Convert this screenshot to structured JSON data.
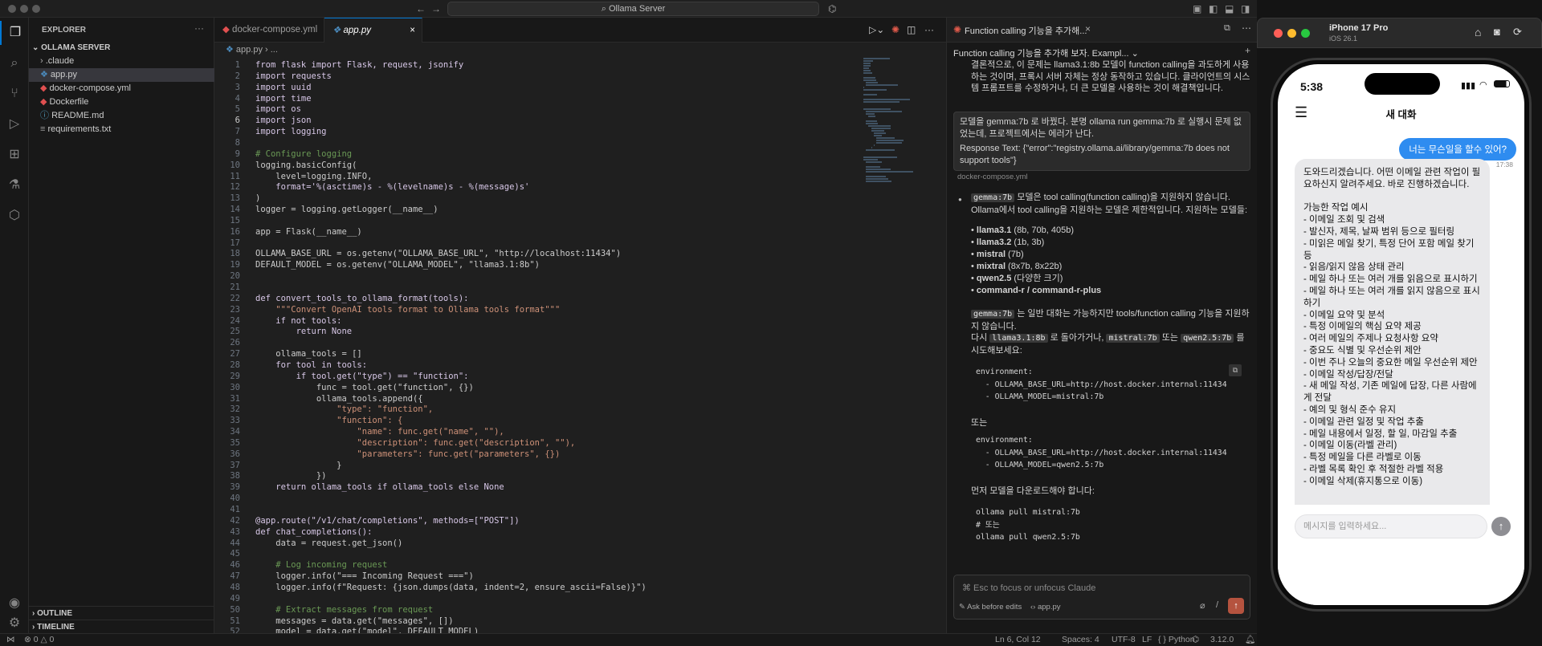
{
  "titlebar": {
    "search": "Ollama Server"
  },
  "sidebar": {
    "title": "EXPLORER",
    "root": "OLLAMA SERVER",
    "files": [
      {
        "name": ".claude"
      },
      {
        "name": "app.py"
      },
      {
        "name": "docker-compose.yml"
      },
      {
        "name": "Dockerfile"
      },
      {
        "name": "README.md"
      },
      {
        "name": "requirements.txt"
      }
    ],
    "outline": "OUTLINE",
    "timeline": "TIMELINE"
  },
  "editor": {
    "tabs": [
      {
        "label": "docker-compose.yml"
      },
      {
        "label": "app.py"
      }
    ],
    "breadcrumb": "app.py  ›  ...",
    "lines": [
      "from flask import Flask, request, jsonify",
      "import requests",
      "import uuid",
      "import time",
      "import os",
      "import json",
      "import logging",
      "",
      "# Configure logging",
      "logging.basicConfig(",
      "    level=logging.INFO,",
      "    format='%(asctime)s - %(levelname)s - %(message)s'",
      ")",
      "logger = logging.getLogger(__name__)",
      "",
      "app = Flask(__name__)",
      "",
      "OLLAMA_BASE_URL = os.getenv(\"OLLAMA_BASE_URL\", \"http://localhost:11434\")",
      "DEFAULT_MODEL = os.getenv(\"OLLAMA_MODEL\", \"llama3.1:8b\")",
      "",
      "",
      "def convert_tools_to_ollama_format(tools):",
      "    \"\"\"Convert OpenAI tools format to Ollama tools format\"\"\"",
      "    if not tools:",
      "        return None",
      "",
      "    ollama_tools = []",
      "    for tool in tools:",
      "        if tool.get(\"type\") == \"function\":",
      "            func = tool.get(\"function\", {})",
      "            ollama_tools.append({",
      "                \"type\": \"function\",",
      "                \"function\": {",
      "                    \"name\": func.get(\"name\", \"\"),",
      "                    \"description\": func.get(\"description\", \"\"),",
      "                    \"parameters\": func.get(\"parameters\", {})",
      "                }",
      "            })",
      "    return ollama_tools if ollama_tools else None",
      "",
      "",
      "@app.route(\"/v1/chat/completions\", methods=[\"POST\"])",
      "def chat_completions():",
      "    data = request.get_json()",
      "",
      "    # Log incoming request",
      "    logger.info(\"=== Incoming Request ===\")",
      "    logger.info(f\"Request: {json.dumps(data, indent=2, ensure_ascii=False)}\")",
      "",
      "    # Extract messages from request",
      "    messages = data.get(\"messages\", [])",
      "    model = data.get(\"model\", DEFAULT_MODEL)"
    ]
  },
  "claude": {
    "tab": "Function calling 기능을 추가해...",
    "session": "Function calling 기능을 추가해 보자. Exampl...",
    "top_text": "결론적으로, 이 문제는 llama3.1:8b 모델이 function calling을 과도하게 사용하는 것이며, 프록시 서버 자체는 정상 동작하고 있습니다. 클라이언트의 시스템 프롬프트를 수정하거나, 더 큰 모델을 사용하는 것이 해결책입니다.",
    "user_msg_1": "모델을 gemma:7b 로 바꿨다. 분명 ollama run gemma:7b 로 실행시 문제 없었는데, 프로젝트에서는 에러가 난다.",
    "user_msg_2": "Response Text: {\"error\":\"registry.ollama.ai/library/gemma:7b does not support tools\"}",
    "file_ref": "docker-compose.yml",
    "resp_code": "gemma:7b",
    "resp_intro": " 모델은 tool calling(function calling)을 지원하지 않습니다. Ollama에서 tool calling을 지원하는 모델은 제한적입니다. 지원하는 모델들:",
    "models": [
      {
        "name": "llama3.1",
        "note": " (8b, 70b, 405b)"
      },
      {
        "name": "llama3.2",
        "note": " (1b, 3b)"
      },
      {
        "name": "mistral",
        "note": " (7b)"
      },
      {
        "name": "mixtral",
        "note": " (8x7b, 8x22b)"
      },
      {
        "name": "qwen2.5",
        "note": " (다양한 크기)"
      },
      {
        "name": "command-r / command-r-plus",
        "note": ""
      }
    ],
    "para2": " 는 일반 대화는 가능하지만 tools/function calling 기능을 지원하지 않습니다.",
    "para3a": "다시 ",
    "code_llama": "llama3.1:8b",
    "para3b": " 로 돌아가거나, ",
    "code_mistral": "mistral:7b",
    "para3c": " 또는 ",
    "code_qwen": "qwen2.5:7b",
    "para3d": " 를 시도해보세요:",
    "block1": "environment:\n  - OLLAMA_BASE_URL=http://host.docker.internal:11434\n  - OLLAMA_MODEL=mistral:7b",
    "or1": "또는",
    "block2": "environment:\n  - OLLAMA_BASE_URL=http://host.docker.internal:11434\n  - OLLAMA_MODEL=qwen2.5:7b",
    "download": "먼저 모델을 다운로드해야 합니다:",
    "block3": "ollama pull mistral:7b\n# 또는\nollama pull qwen2.5:7b",
    "input_placeholder": "⌘ Esc to focus or unfocus Claude",
    "ask_label": "Ask before edits",
    "file_chip": "app.py"
  },
  "status": {
    "problems": "0",
    "warnings": "0",
    "position": "Ln 6, Col 12",
    "spaces": "Spaces: 4",
    "encoding": "UTF-8",
    "eol": "LF",
    "language": "Python",
    "version": "3.12.0"
  },
  "simulator": {
    "device": "iPhone 17 Pro",
    "os": "iOS 26.1",
    "time": "5:38",
    "title": "새 대화",
    "sent_msg": "너는 무슨일을 할수 있어?",
    "sent_time": "17:38",
    "reply": "도와드리겠습니다. 어떤 이메일 관련 작업이 필요하신지 알려주세요. 바로 진행하겠습니다.\n\n가능한 작업 예시\n- 이메일 조회 및 검색\n  - 발신자, 제목, 날짜 범위 등으로 필터링\n  - 미읽은 메일 찾기, 특정 단어 포함 메일 찾기 등\n- 읽음/읽지 않음 상태 관리\n  - 메일 하나 또는 여러 개를 읽음으로 표시하기\n  - 메일 하나 또는 여러 개를 읽지 않음으로 표시하기\n- 이메일 요약 및 분석\n  - 특정 이메일의 핵심 요약 제공\n  - 여러 메일의 주제나 요청사항 요약\n  - 중요도 식별 및 우선순위 제안\n  - 이번 주나 오늘의 중요한 메일 우선순위 제안\n- 이메일 작성/답장/전달\n  - 새 메일 작성, 기존 메일에 답장, 다른 사람에게 전달\n  - 예의 및 형식 준수 유지\n- 이메일 관련 일정 및 작업 추출\n  - 메일 내용에서 일정, 할 일, 마감일 추출\n- 이메일 이동(라벨 관리)\n  - 특정 메일을 다른 라벨로 이동\n  - 라벨 목록 확인 후 적절한 라벨 적용\n- 이메일 삭제(휴지통으로 이동)",
    "input_placeholder": "메시지를 입력하세요..."
  },
  "colors": {
    "accent": "#0078d4",
    "bubble_blue": "#2e8cf0",
    "keyword": "#c586c0",
    "string": "#ce9178",
    "comment": "#6a9955"
  }
}
